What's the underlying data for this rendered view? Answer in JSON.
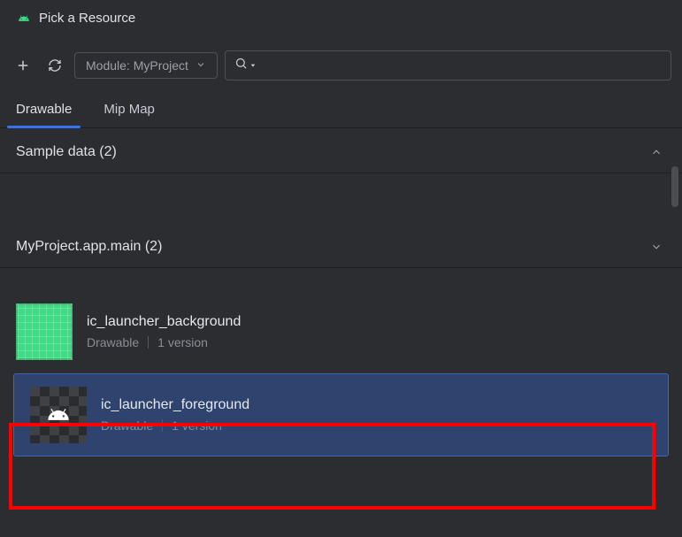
{
  "window": {
    "title": "Pick a Resource"
  },
  "toolbar": {
    "module_label": "Module: MyProject",
    "search_placeholder": ""
  },
  "tabs": [
    {
      "label": "Drawable",
      "active": true
    },
    {
      "label": "Mip Map",
      "active": false
    }
  ],
  "sections": [
    {
      "title": "Sample data (2)",
      "expanded": false,
      "items": []
    },
    {
      "title": "MyProject.app.main (2)",
      "expanded": true,
      "items": [
        {
          "name": "ic_launcher_background",
          "type_label": "Drawable",
          "version_label": "1 version",
          "thumb_kind": "green-grid",
          "selected": false
        },
        {
          "name": "ic_launcher_foreground",
          "type_label": "Drawable",
          "version_label": "1 version",
          "thumb_kind": "checker-android",
          "selected": true
        }
      ]
    }
  ],
  "icons": {
    "android": "android-icon",
    "add": "add-icon",
    "refresh": "refresh-icon",
    "chevron_down": "chevron-down-icon",
    "chevron_up": "chevron-up-icon",
    "search": "search-icon"
  }
}
